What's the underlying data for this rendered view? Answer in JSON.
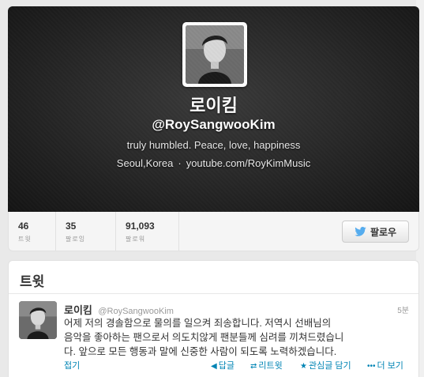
{
  "profile": {
    "name": "로이킴",
    "handle": "@RoySangwooKim",
    "bio": "truly humbled. Peace, love, happiness",
    "location": "Seoul,Korea",
    "separator": "·",
    "website": "youtube.com/RoyKimMusic"
  },
  "stats": [
    {
      "value": "46",
      "label": "트윗"
    },
    {
      "value": "35",
      "label": "팔로잉"
    },
    {
      "value": "91,093",
      "label": "팔로워"
    }
  ],
  "follow_button": {
    "label": "팔로우",
    "icon": "twitter-bird-icon"
  },
  "tweets_section": {
    "title": "트윗"
  },
  "tweet": {
    "name": "로이킴",
    "handle": "@RoySangwooKim",
    "time": "5분",
    "lines": [
      "어제 저의 경솔함으로 물의를 일으켜 죄송합니다. 저역시 선배님의",
      "음악을 좋아하는 팬으로서 의도치않게 팬분들께 심려를 끼쳐드렸습니",
      "다. 앞으로 모든 행동과 말에 신중한 사람이 되도록 노력하겠습니다."
    ],
    "collapse": "접기",
    "actions": {
      "reply": {
        "label": "답글",
        "icon": "reply-icon"
      },
      "retweet": {
        "label": "리트윗",
        "icon": "retweet-icon"
      },
      "favorite": {
        "label": "관심글 담기",
        "icon": "star-icon"
      },
      "more": {
        "label": "더 보기",
        "icon": "more-icon"
      }
    }
  },
  "colors": {
    "link": "#0084b4",
    "header_bg": "#2a2a2a",
    "twitter_blue": "#55acee"
  }
}
